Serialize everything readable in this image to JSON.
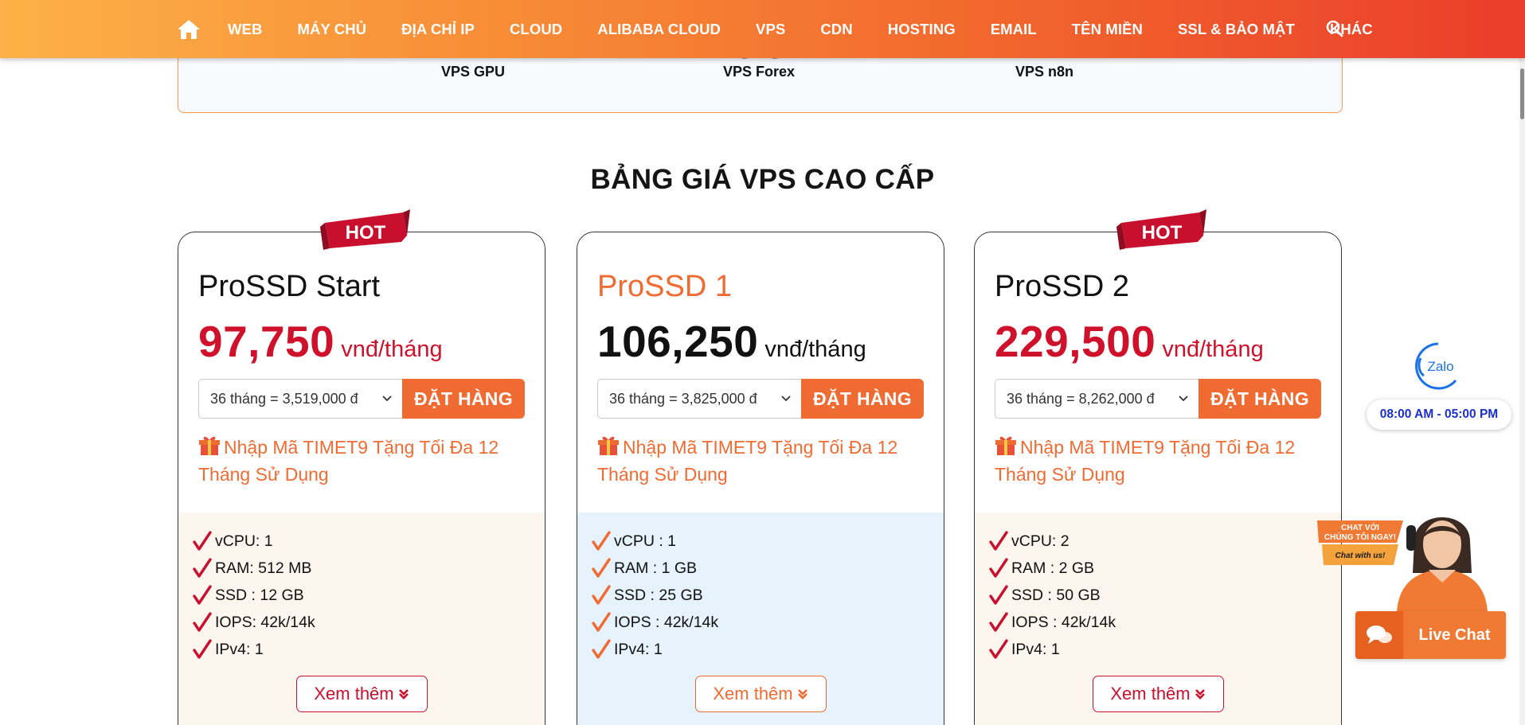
{
  "nav": {
    "items": [
      "WEB",
      "MÁY CHỦ",
      "ĐỊA CHỈ IP",
      "CLOUD",
      "ALIBABA CLOUD",
      "VPS",
      "CDN",
      "HOSTING",
      "EMAIL",
      "TÊN MIỀN",
      "SSL & BẢO MẬT",
      "KHÁC"
    ]
  },
  "top_box": {
    "labels": [
      "VPS GPU",
      "VPS Forex",
      "VPS n8n"
    ]
  },
  "section_title": "BẢNG GIÁ VPS CAO CẤP",
  "cards": [
    {
      "name": "ProSSD Start",
      "price": "97,750",
      "unit": "vnđ/tháng",
      "select": "36 tháng = 3,519,000 đ",
      "order": "ĐẶT HÀNG",
      "promo": "Nhập Mã TIMET9 Tặng Tối Đa 12 Tháng Sử Dụng",
      "specs": [
        "vCPU: 1",
        "RAM: 512 MB",
        "SSD : 12 GB",
        "IOPS: 42k/14k",
        "IPv4: 1"
      ],
      "more": "Xem thêm",
      "hot": "HOT"
    },
    {
      "name": "ProSSD 1",
      "price": "106,250",
      "unit": "vnđ/tháng",
      "select": "36 tháng = 3,825,000 đ",
      "order": "ĐẶT HÀNG",
      "promo": "Nhập Mã TIMET9 Tặng Tối Đa 12 Tháng Sử Dụng",
      "specs": [
        "vCPU : 1",
        "RAM : 1 GB",
        "SSD : 25 GB",
        "IOPS : 42k/14k",
        "IPv4: 1"
      ],
      "more": "Xem thêm"
    },
    {
      "name": "ProSSD 2",
      "price": "229,500",
      "unit": "vnđ/tháng",
      "select": "36 tháng = 8,262,000 đ",
      "order": "ĐẶT HÀNG",
      "promo": "Nhập Mã TIMET9 Tặng Tối Đa 12 Tháng Sử Dụng",
      "specs": [
        "vCPU: 2",
        "RAM : 2 GB",
        "SSD : 50 GB",
        "IOPS : 42k/14k",
        "IPv4: 1"
      ],
      "more": "Xem thêm",
      "hot": "HOT"
    }
  ],
  "widgets": {
    "zalo": "Zalo",
    "hours": "08:00 AM - 05:00 PM",
    "chat_bubble_line1": "CHAT VỚI",
    "chat_bubble_line2": "CHÚNG TÔI NGAY!",
    "chat_bubble_line3": "Chat with us!",
    "live_chat": "Live Chat"
  },
  "colors": {
    "accent_orange": "#f06b32",
    "price_red": "#d0112b",
    "hot_red": "#c8102e"
  }
}
